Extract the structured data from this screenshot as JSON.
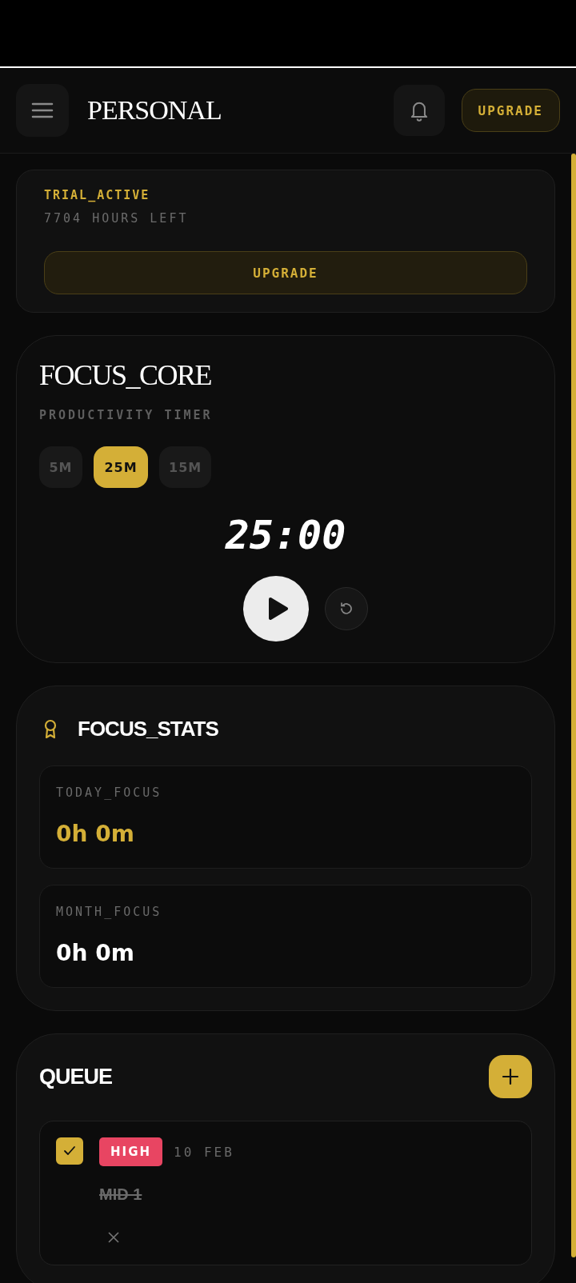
{
  "header": {
    "title": "PERSONAL",
    "upgrade_label": "UPGRADE"
  },
  "trial": {
    "status": "TRIAL_ACTIVE",
    "remaining": "7704 HOURS LEFT",
    "button": "UPGRADE"
  },
  "timer": {
    "title": "FOCUS_CORE",
    "subtitle": "PRODUCTIVITY TIMER",
    "presets": [
      {
        "label": "5M",
        "selected": false
      },
      {
        "label": "25M",
        "selected": true
      },
      {
        "label": "15M",
        "selected": false
      }
    ],
    "time": "25:00"
  },
  "stats": {
    "title": "FOCUS_STATS",
    "items": [
      {
        "label": "TODAY_FOCUS",
        "value": "0h 0m",
        "color": "#d4af37"
      },
      {
        "label": "MONTH_FOCUS",
        "value": "0h 0m",
        "color": "#ffffff"
      }
    ]
  },
  "queue": {
    "title": "QUEUE",
    "tasks": [
      {
        "checked": true,
        "priority": "HIGH",
        "color": "#e84562",
        "date": "10 FEB",
        "title": "MID 1"
      }
    ]
  }
}
